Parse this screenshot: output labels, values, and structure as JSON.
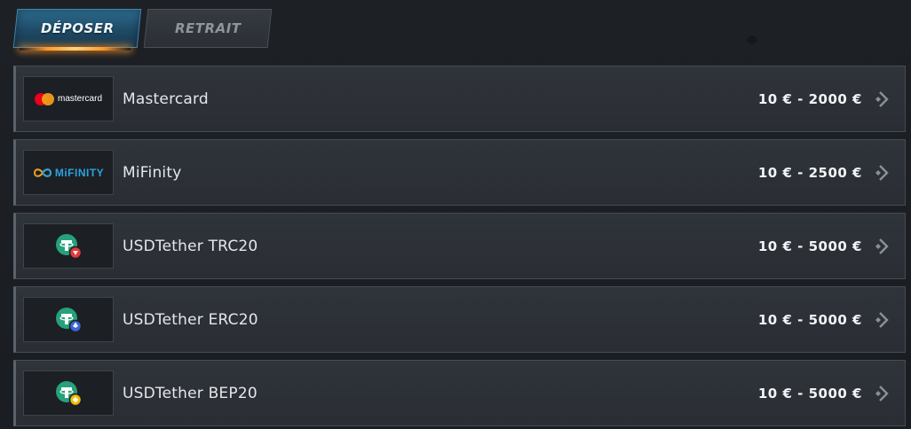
{
  "tabs": [
    {
      "label": "DÉPOSER",
      "active": true
    },
    {
      "label": "RETRAIT",
      "active": false
    }
  ],
  "methods": [
    {
      "name": "Mastercard",
      "range": "10 € - 2000 €",
      "logo_text": "mastercard",
      "icon": "mastercard-icon"
    },
    {
      "name": "MiFinity",
      "range": "10 € - 2500 €",
      "logo_text": "MiFINITY",
      "icon": "mifinity-icon"
    },
    {
      "name": "USDTether TRC20",
      "range": "10 € - 5000 €",
      "icon": "tether-trc20-icon",
      "badge_color": "#e03a3a"
    },
    {
      "name": "USDTether ERC20",
      "range": "10 € - 5000 €",
      "icon": "tether-erc20-icon",
      "badge_color": "#3d64d6"
    },
    {
      "name": "USDTether BEP20",
      "range": "10 € - 5000 €",
      "icon": "tether-bep20-icon",
      "badge_color": "#f0b90b"
    }
  ],
  "colors": {
    "tether_green": "#26a17b",
    "accent_blue": "#2d6c8f",
    "active_glow": "#ff9a2e"
  }
}
